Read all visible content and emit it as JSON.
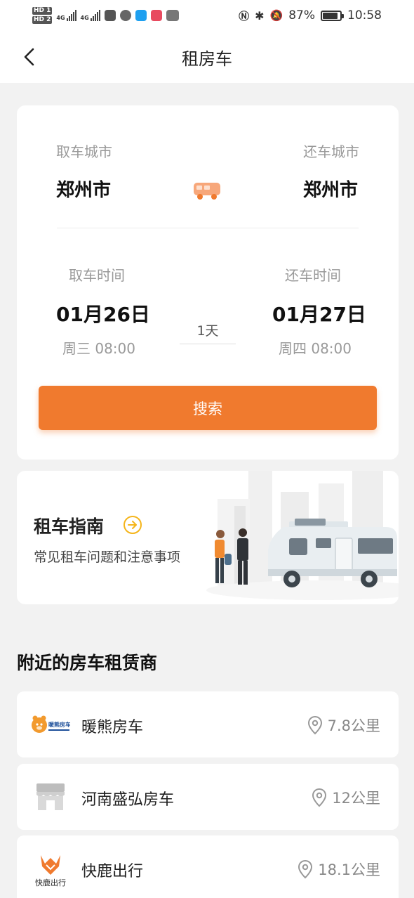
{
  "status_bar": {
    "hd1": "HD 1",
    "hd2": "HD 2",
    "net1": "4G",
    "net2": "4G",
    "battery": "87%",
    "time": "10:58"
  },
  "nav": {
    "title": "租房车"
  },
  "rental": {
    "pickup_city_label": "取车城市",
    "pickup_city": "郑州市",
    "return_city_label": "还车城市",
    "return_city": "郑州市",
    "pickup_time_label": "取车时间",
    "pickup_date": "01月26日",
    "pickup_week": "周三 08:00",
    "duration": "1天",
    "return_time_label": "还车时间",
    "return_date": "01月27日",
    "return_week": "周四 08:00",
    "search_label": "搜索"
  },
  "guide": {
    "title": "租车指南",
    "subtitle": "常见租车问题和注意事项"
  },
  "nearby": {
    "title": "附近的房车租赁商",
    "vendors": [
      {
        "name": "暖熊房车",
        "distance": "7.8公里",
        "logo_text": "暖熊房车"
      },
      {
        "name": "河南盛弘房车",
        "distance": "12公里"
      },
      {
        "name": "快鹿出行",
        "distance": "18.1公里",
        "logo_text": "快鹿出行"
      }
    ]
  },
  "colors": {
    "accent": "#f07a2e",
    "background": "#f2f2f2"
  }
}
